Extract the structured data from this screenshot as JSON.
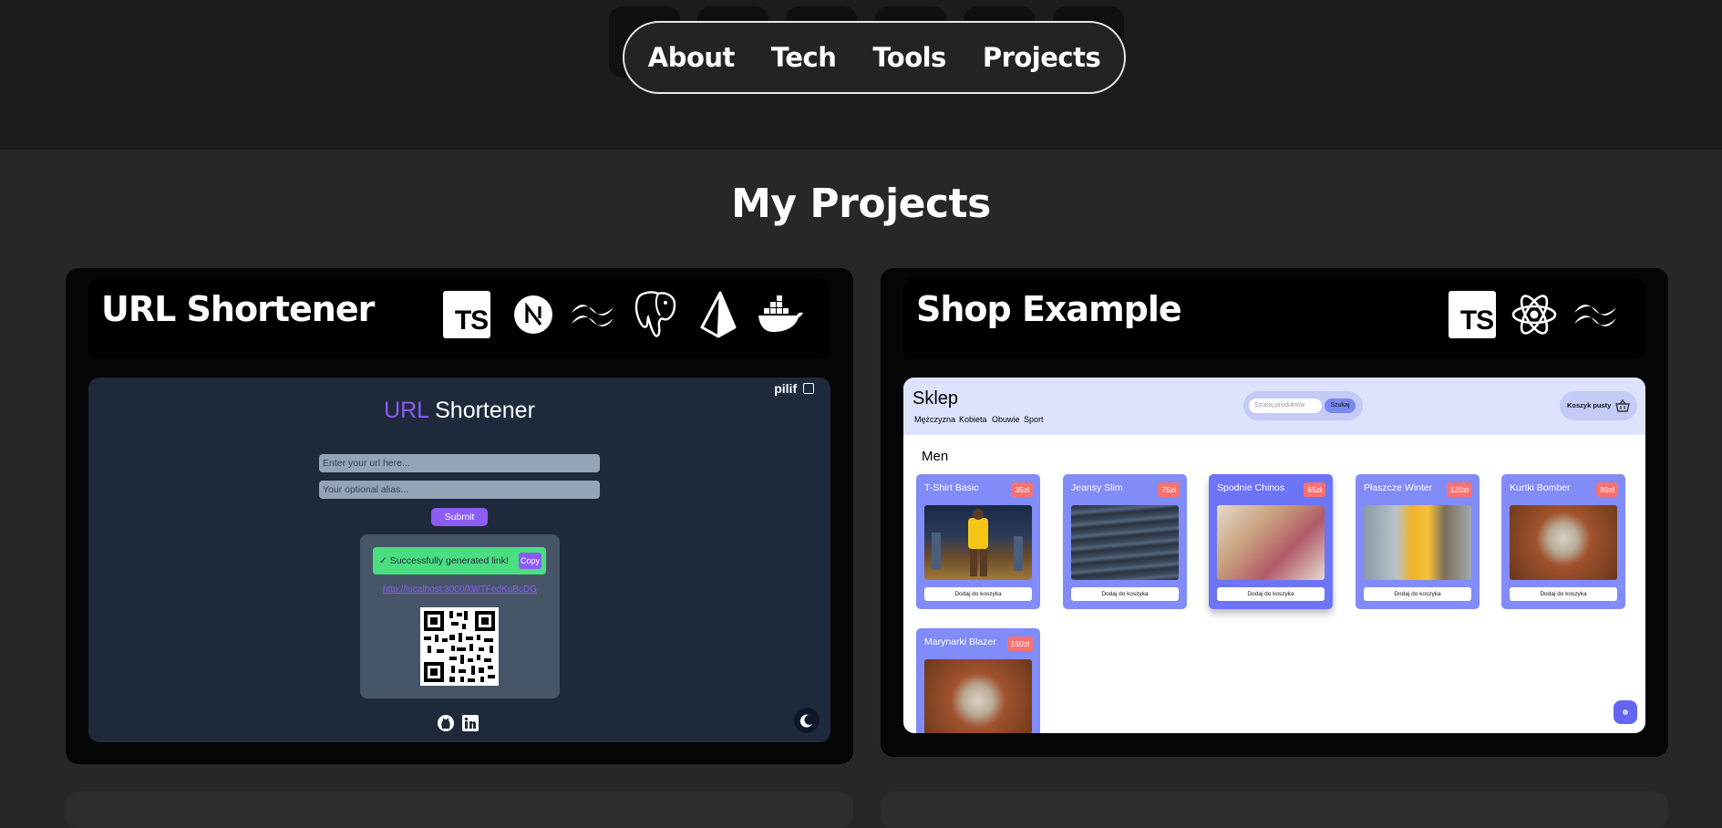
{
  "nav": {
    "items": [
      "About",
      "Tech",
      "Tools",
      "Projects"
    ]
  },
  "page_title": "My Projects",
  "projects": [
    {
      "title": "URL Shortener",
      "tech_icons": [
        "typescript-icon",
        "nextjs-icon",
        "tailwind-icon",
        "postgresql-icon",
        "prisma-icon",
        "docker-icon"
      ],
      "tech_label": "TS",
      "preview": {
        "user": "pilif",
        "heading_accent": "URL",
        "heading_rest": "Shortener",
        "url_placeholder": "Enter your url here...",
        "alias_placeholder": "Your optional alias...",
        "submit": "Submit",
        "success": "✓ Successfully generated link!",
        "copy": "Copy",
        "link": "http://localhost:3000/kWTFedKuBcDG"
      }
    },
    {
      "title": "Shop Example",
      "tech_icons": [
        "typescript-icon",
        "react-icon",
        "tailwind-icon"
      ],
      "tech_label": "TS",
      "preview": {
        "brand": "Sklep",
        "categories": [
          "Mężczyzna",
          "Kobieta",
          "Obuwie",
          "Sport"
        ],
        "search_placeholder": "Szukaj produktów",
        "search_button": "Szukaj",
        "cart": "Koszyk pusty",
        "section": "Men",
        "add_label": "Dodaj do koszyka",
        "products": [
          {
            "name": "T-Shirt Basic",
            "price": "35zł"
          },
          {
            "name": "Jeansy Slim",
            "price": "75zł"
          },
          {
            "name": "Spodnie Chinos",
            "price": "65zł"
          },
          {
            "name": "Płaszcze Winter",
            "price": "120zł"
          },
          {
            "name": "Kurtki Bomber",
            "price": "89zł"
          },
          {
            "name": "Marynarki Blazer",
            "price": "150zł"
          }
        ]
      }
    }
  ],
  "colors": {
    "accent": "#8b5cf6",
    "product_card": "#818cf8",
    "price_badge": "#f87171",
    "success": "#4ade80"
  }
}
